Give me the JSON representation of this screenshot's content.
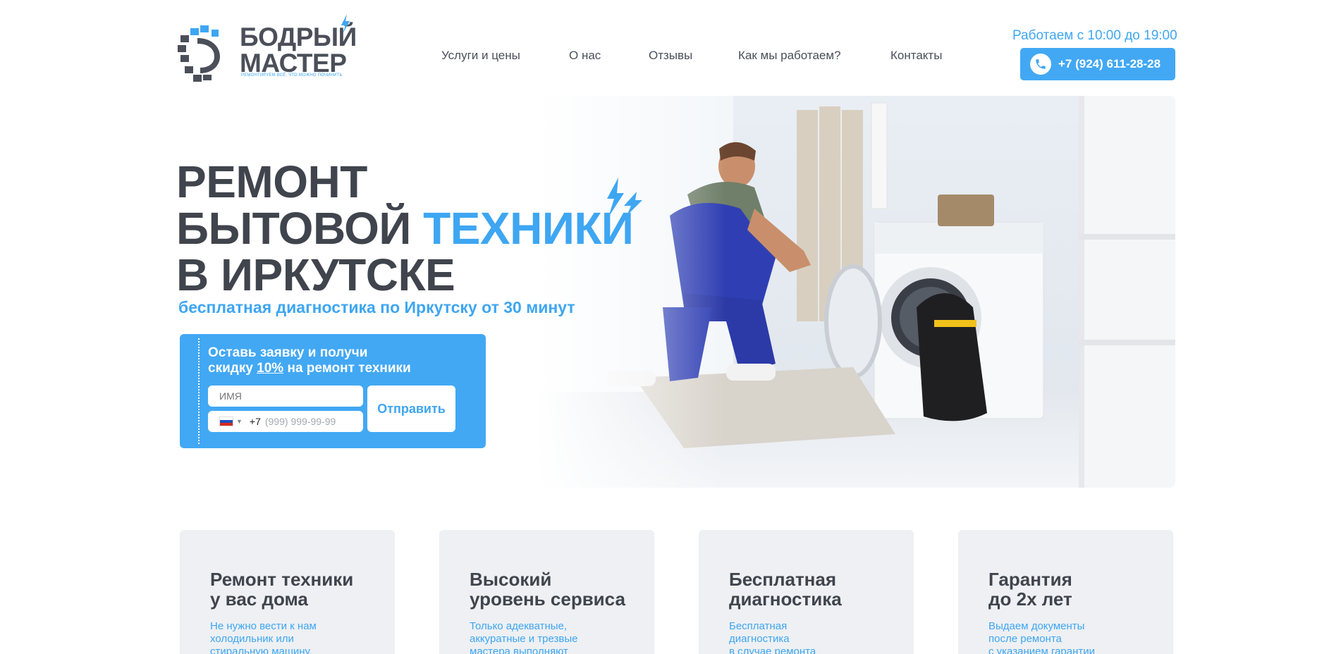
{
  "header": {
    "logo": {
      "title_line1": "БОДРЫЙ",
      "title_line2": "МАСТЕР",
      "tagline": "РЕМОНТИРУЕМ ВСЁ, ЧТО МОЖНО ПОЧИНИТЬ",
      "icon": "gear-bolt-logo-icon"
    },
    "nav": [
      {
        "label": "Услуги и цены"
      },
      {
        "label": "О нас"
      },
      {
        "label": "Отзывы"
      },
      {
        "label": "Как мы работаем?"
      },
      {
        "label": "Контакты"
      }
    ],
    "work_hours": "Работаем с 10:00 до 19:00",
    "phone": "+7 (924) 611-28-28",
    "phone_icon": "phone-icon"
  },
  "hero": {
    "title_line1": "РЕМОНТ",
    "title_line2_a": "БЫТОВОЙ ",
    "title_line2_b": "ТЕХНИКИ",
    "title_line3": "В ИРКУТСКЕ",
    "subtitle": "бесплатная диагностика по Иркутску от 30 минут",
    "bolt_icon": "lightning-bolt-icon",
    "photo": "repairman-fixing-washing-machine-photo"
  },
  "form": {
    "title_a": "Оставь заявку и получи",
    "title_b": "скидку ",
    "title_pct": "10%",
    "title_c": " на ремонт техники",
    "name_placeholder": "ИМЯ",
    "phone_code": "+7",
    "phone_placeholder": "(999) 999-99-99",
    "submit_label": "Отправить",
    "flag_icon": "russia-flag-icon"
  },
  "features": [
    {
      "title": "Ремонт техники\nу вас дома",
      "text": "Не нужно вести к нам\nхолодильник или\nстиральную машину,"
    },
    {
      "title": "Высокий\nуровень сервиса",
      "text": "Только адекватные,\nаккуратные и трезвые\nмастера выполняют"
    },
    {
      "title": "Бесплатная\nдиагностика",
      "text": "Бесплатная\nдиагностика\nв случае ремонта"
    },
    {
      "title": "Гарантия\nдо 2х лет",
      "text": "Выдаем документы\nпосле ремонта\nс указанием гарантии"
    }
  ],
  "colors": {
    "accent": "#3ea6f2",
    "button": "#42a8f4",
    "text_dark": "#40444d",
    "card_bg": "#eef0f3"
  }
}
